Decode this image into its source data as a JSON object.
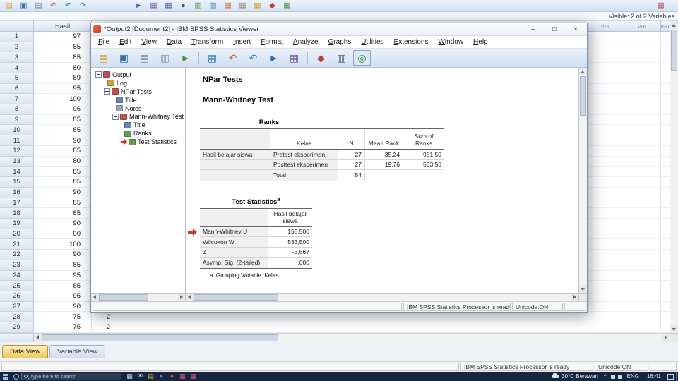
{
  "editor": {
    "visible_info": "Visible: 2 of 2 Variables",
    "toolbar_left_icons": [
      {
        "name": "open-data-icon",
        "glyph": "▤",
        "color": "#d89b2f"
      },
      {
        "name": "save-icon",
        "glyph": "▣",
        "color": "#3d6fb0"
      },
      {
        "name": "print-icon",
        "glyph": "▤",
        "color": "#75879c"
      },
      {
        "name": "recall-dialogs-icon",
        "glyph": "↶",
        "color": "#c65a3c"
      },
      {
        "name": "undo-icon",
        "glyph": "↶",
        "color": "#3f86c9"
      },
      {
        "name": "redo-icon",
        "glyph": "↷",
        "color": "#3f86c9"
      }
    ],
    "toolbar_mid_icons": [
      {
        "name": "goto-case-icon",
        "glyph": "►",
        "color": "#3d6fb0"
      },
      {
        "name": "goto-variable-icon",
        "glyph": "▦",
        "color": "#7a5fa0"
      },
      {
        "name": "variables-icon",
        "glyph": "▦",
        "color": "#5b5b8a"
      },
      {
        "name": "find-icon",
        "glyph": "●",
        "color": "#555555"
      },
      {
        "name": "insert-cases-icon",
        "glyph": "▥",
        "color": "#5f9e48"
      },
      {
        "name": "insert-variable-icon",
        "glyph": "▥",
        "color": "#4a8ac2"
      },
      {
        "name": "split-file-icon",
        "glyph": "▦",
        "color": "#d0763a"
      },
      {
        "name": "weight-cases-icon",
        "glyph": "▦",
        "color": "#8d8d8d"
      },
      {
        "name": "select-cases-icon",
        "glyph": "▦",
        "color": "#c9a22f"
      },
      {
        "name": "value-labels-icon",
        "glyph": "◆",
        "color": "#c43b3b"
      },
      {
        "name": "use-variable-sets-icon",
        "glyph": "▦",
        "color": "#4f9440"
      }
    ],
    "toolbar_right_icons": [
      {
        "name": "show-variables-icon",
        "glyph": "▦",
        "color": "#b44b4b"
      }
    ],
    "grid": {
      "hasil_header": "Hasil",
      "var_header": "var",
      "rows": [
        {
          "n": "1",
          "a": "97",
          "b": ""
        },
        {
          "n": "2",
          "a": "85",
          "b": ""
        },
        {
          "n": "3",
          "a": "85",
          "b": ""
        },
        {
          "n": "4",
          "a": "80",
          "b": ""
        },
        {
          "n": "5",
          "a": "89",
          "b": ""
        },
        {
          "n": "6",
          "a": "95",
          "b": ""
        },
        {
          "n": "7",
          "a": "100",
          "b": ""
        },
        {
          "n": "8",
          "a": "96",
          "b": ""
        },
        {
          "n": "9",
          "a": "85",
          "b": ""
        },
        {
          "n": "10",
          "a": "85",
          "b": ""
        },
        {
          "n": "11",
          "a": "90",
          "b": ""
        },
        {
          "n": "12",
          "a": "85",
          "b": ""
        },
        {
          "n": "13",
          "a": "80",
          "b": ""
        },
        {
          "n": "14",
          "a": "85",
          "b": ""
        },
        {
          "n": "15",
          "a": "85",
          "b": ""
        },
        {
          "n": "16",
          "a": "90",
          "b": ""
        },
        {
          "n": "17",
          "a": "85",
          "b": ""
        },
        {
          "n": "18",
          "a": "85",
          "b": ""
        },
        {
          "n": "19",
          "a": "90",
          "b": ""
        },
        {
          "n": "20",
          "a": "90",
          "b": ""
        },
        {
          "n": "21",
          "a": "100",
          "b": ""
        },
        {
          "n": "22",
          "a": "90",
          "b": ""
        },
        {
          "n": "23",
          "a": "85",
          "b": ""
        },
        {
          "n": "24",
          "a": "95",
          "b": ""
        },
        {
          "n": "25",
          "a": "85",
          "b": ""
        },
        {
          "n": "26",
          "a": "95",
          "b": ""
        },
        {
          "n": "27",
          "a": "90",
          "b": ""
        },
        {
          "n": "28",
          "a": "75",
          "b": "2"
        },
        {
          "n": "29",
          "a": "75",
          "b": "2"
        }
      ]
    },
    "tabs": [
      {
        "label": "Data View",
        "active": true
      },
      {
        "label": "Variable View",
        "active": false
      }
    ],
    "status": {
      "processor": "IBM SPSS Statistics Processor is ready",
      "unicode": "Unicode:ON"
    }
  },
  "viewer": {
    "title": "*Output2 [Document2] - IBM SPSS Statistics Viewer",
    "window_buttons": {
      "minimize": "–",
      "maximize": "□",
      "close": "×"
    },
    "menus": [
      "File",
      "Edit",
      "View",
      "Data",
      "Transform",
      "Insert",
      "Format",
      "Analyze",
      "Graphs",
      "Utilities",
      "Extensions",
      "Window",
      "Help"
    ],
    "toolbar_icons": [
      {
        "name": "open-output-icon",
        "glyph": "▤",
        "color": "#d89b2f"
      },
      {
        "name": "save-output-icon",
        "glyph": "▣",
        "color": "#3d6fb0"
      },
      {
        "name": "print-icon",
        "glyph": "▤",
        "color": "#75879c"
      },
      {
        "name": "print-preview-icon",
        "glyph": "▥",
        "color": "#8fa3b8"
      },
      {
        "name": "export-icon",
        "glyph": "►",
        "color": "#4f9440"
      },
      {
        "name": "goto-data-icon",
        "glyph": "▦",
        "color": "#4a86c8"
      },
      {
        "name": "recall-dialogs-icon",
        "glyph": "↶",
        "color": "#c65a3c"
      },
      {
        "name": "undo-icon",
        "glyph": "↶",
        "color": "#3f86c9"
      },
      {
        "name": "goto-case-icon",
        "glyph": "►",
        "color": "#2e6db0"
      },
      {
        "name": "variables-icon",
        "glyph": "▦",
        "color": "#7a5fa0"
      },
      {
        "name": "select-last-output-icon",
        "glyph": "◆",
        "color": "#c43b3b"
      },
      {
        "name": "show-hide-icon",
        "glyph": "▥",
        "color": "#6f6f6f"
      },
      {
        "name": "designate-window-icon",
        "glyph": "◎",
        "color": "#2f9a3e"
      }
    ],
    "tree": [
      {
        "label": "Output",
        "level": 0,
        "icon": "output-book-icon",
        "color": "#c0504d",
        "expander": true
      },
      {
        "label": "Log",
        "level": 1,
        "icon": "log-icon",
        "color": "#c8a23c"
      },
      {
        "label": "NPar Tests",
        "level": 1,
        "icon": "procedure-icon",
        "color": "#c0504d",
        "expander": true
      },
      {
        "label": "Title",
        "level": 2,
        "icon": "title-icon",
        "color": "#6a85b5"
      },
      {
        "label": "Notes",
        "level": 2,
        "icon": "notes-icon",
        "color": "#9aa7b8"
      },
      {
        "label": "Mann-Whitney Test",
        "level": 2,
        "icon": "procedure-icon",
        "color": "#c0504d",
        "expander": true
      },
      {
        "label": "Title",
        "level": 3,
        "icon": "title-icon",
        "color": "#6a85b5"
      },
      {
        "label": "Ranks",
        "level": 3,
        "icon": "table-icon",
        "color": "#5f9e48"
      },
      {
        "label": "Test Statistics",
        "level": 3,
        "icon": "table-icon",
        "color": "#5f9e48",
        "selected": true
      }
    ],
    "content": {
      "h1": "NPar Tests",
      "h2": "Mann-Whitney Test",
      "ranks": {
        "title": "Ranks",
        "row_label": "Hasil belajar siswa",
        "headers": [
          "Kelas",
          "N",
          "Mean Rank",
          "Sum of Ranks"
        ],
        "rows": [
          {
            "kelas": "Pretest eksperimen",
            "n": "27",
            "mean": "35,24",
            "sum": "951,50"
          },
          {
            "kelas": "Posttest eksperimen",
            "n": "27",
            "mean": "19,76",
            "sum": "533,50"
          },
          {
            "kelas": "Total",
            "n": "54",
            "mean": "",
            "sum": ""
          }
        ]
      },
      "test_statistics": {
        "title": "Test Statistics",
        "superscript": "a",
        "col_header": "Hasil belajar siswa",
        "rows": [
          {
            "label": "Mann-Whitney U",
            "value": "155,500"
          },
          {
            "label": "Wilcoxon W",
            "value": "533,500"
          },
          {
            "label": "Z",
            "value": "-3,667"
          },
          {
            "label": "Asymp. Sig. (2-tailed)",
            "value": ",000"
          }
        ],
        "footnote": "a. Grouping Variable: Kelas"
      }
    },
    "status": {
      "processor": "IBM SPSS Statistics Processor is ready",
      "unicode": "Unicode:ON"
    }
  },
  "taskbar": {
    "search_placeholder": "Type here to search",
    "weather": "30°C Berawan",
    "tray_chevron": "^",
    "language": "ENG",
    "time": "16:41",
    "app_icons": [
      {
        "name": "task-view-icon",
        "glyph": "▦",
        "color": "#cfd8e6"
      },
      {
        "name": "mail-icon",
        "glyph": "✉",
        "color": "#cfd8e6"
      },
      {
        "name": "file-explorer-icon",
        "glyph": "▤",
        "color": "#e5b33c"
      },
      {
        "name": "edge-icon",
        "glyph": "●",
        "color": "#3f8fe0"
      },
      {
        "name": "chrome-icon",
        "glyph": "●",
        "color": "#e04a3a"
      },
      {
        "name": "spss-statistics-icon",
        "glyph": "▦",
        "color": "#e2557e"
      },
      {
        "name": "spss-viewer-icon",
        "glyph": "▦",
        "color": "#e2557e"
      }
    ]
  }
}
